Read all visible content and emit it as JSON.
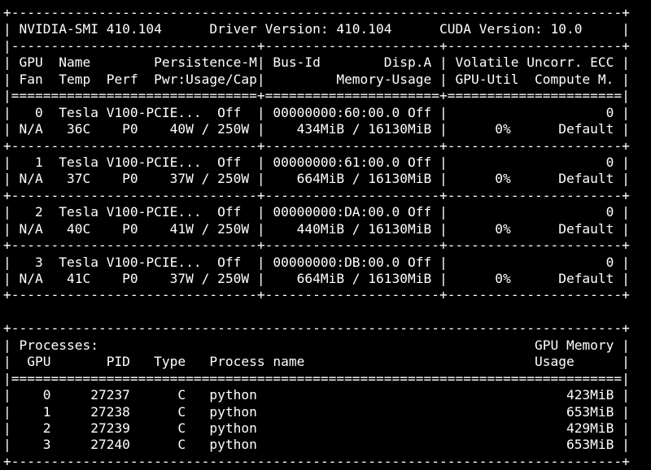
{
  "colors": {
    "background": "#000000",
    "foreground": "#ffffff"
  },
  "terminal_lines": [
    "+-----------------------------------------------------------------------------+",
    "| NVIDIA-SMI 410.104      Driver Version: 410.104      CUDA Version: 10.0     |",
    "|-------------------------------+----------------------+----------------------+",
    "| GPU  Name        Persistence-M| Bus-Id        Disp.A | Volatile Uncorr. ECC |",
    "| Fan  Temp  Perf  Pwr:Usage/Cap|         Memory-Usage | GPU-Util  Compute M. |",
    "|===============================+======================+======================|",
    "|   0  Tesla V100-PCIE...  Off  | 00000000:60:00.0 Off |                    0 |",
    "| N/A   36C    P0    40W / 250W |    434MiB / 16130MiB |      0%      Default |",
    "+-------------------------------+----------------------+----------------------+",
    "|   1  Tesla V100-PCIE...  Off  | 00000000:61:00.0 Off |                    0 |",
    "| N/A   37C    P0    37W / 250W |    664MiB / 16130MiB |      0%      Default |",
    "+-------------------------------+----------------------+----------------------+",
    "|   2  Tesla V100-PCIE...  Off  | 00000000:DA:00.0 Off |                    0 |",
    "| N/A   40C    P0    41W / 250W |    440MiB / 16130MiB |      0%      Default |",
    "+-------------------------------+----------------------+----------------------+",
    "|   3  Tesla V100-PCIE...  Off  | 00000000:DB:00.0 Off |                    0 |",
    "| N/A   41C    P0    37W / 250W |    664MiB / 16130MiB |      0%      Default |",
    "+-------------------------------+----------------------+----------------------+",
    "",
    "+-----------------------------------------------------------------------------+",
    "| Processes:                                                       GPU Memory |",
    "|  GPU       PID   Type   Process name                             Usage      |",
    "|=============================================================================|",
    "|    0     27237      C   python                                       423MiB |",
    "|    1     27238      C   python                                       653MiB |",
    "|    2     27239      C   python                                       429MiB |",
    "|    3     27240      C   python                                       653MiB |",
    "+-----------------------------------------------------------------------------+"
  ]
}
